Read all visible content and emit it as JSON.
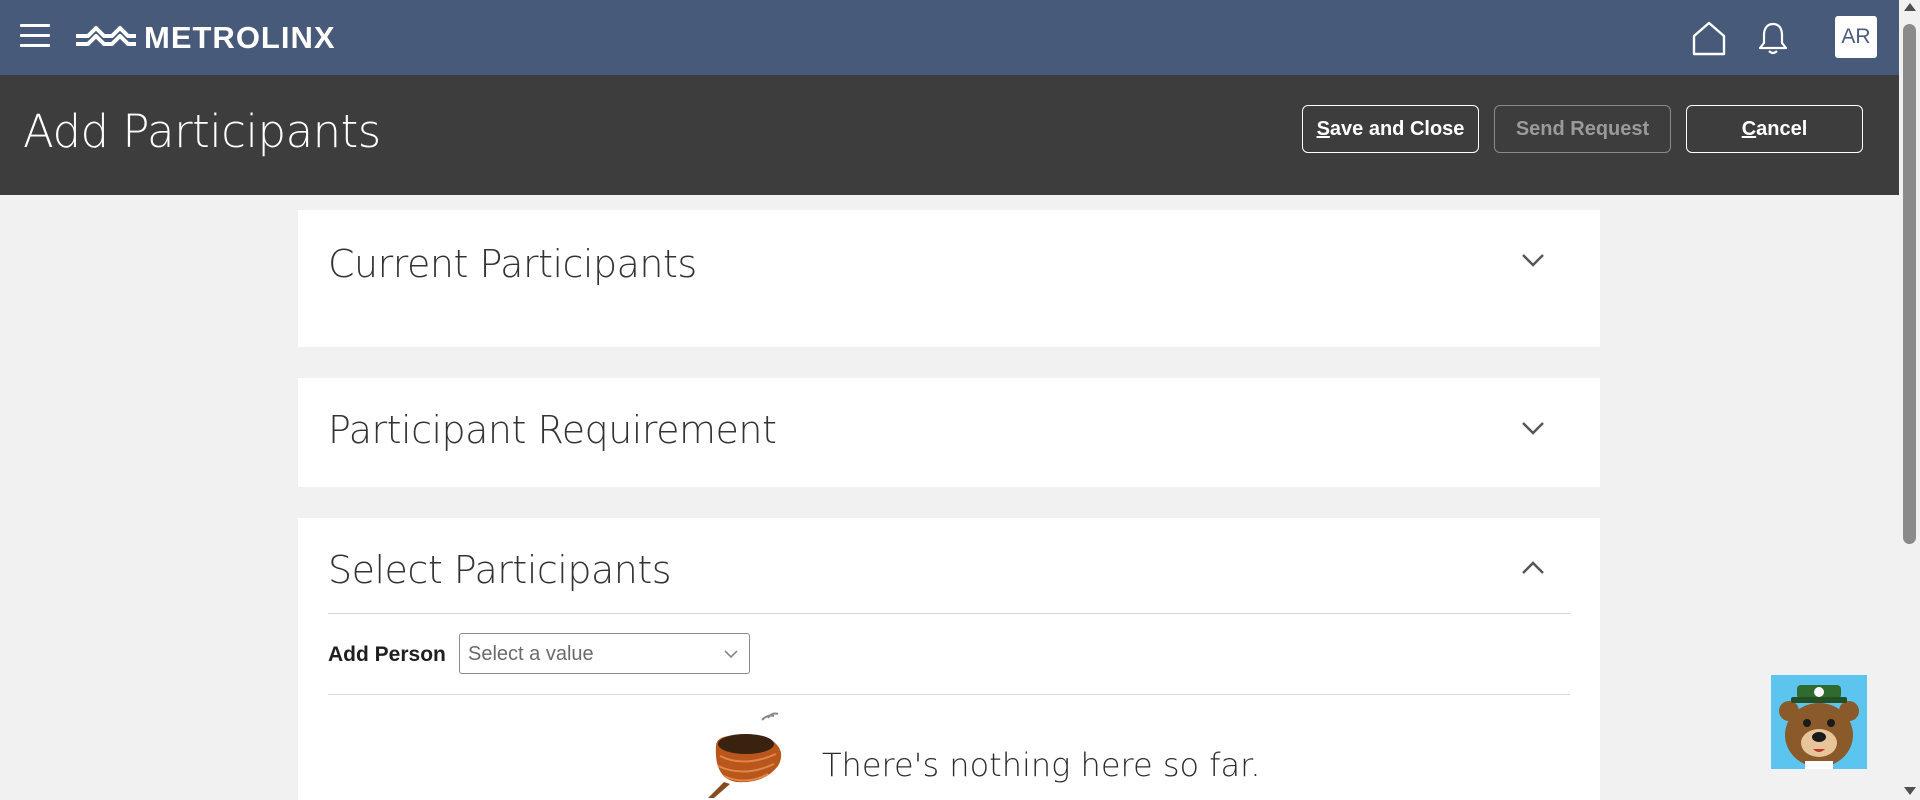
{
  "nav": {
    "brand": "METROLINX",
    "avatar_initials": "AR",
    "icons": [
      "menu-icon",
      "home-icon",
      "bell-icon"
    ]
  },
  "header": {
    "title": "Add Participants",
    "save_first": "S",
    "save_rest": "ave and Close",
    "send_label": "Send Request",
    "cancel_first": "C",
    "cancel_rest": "ancel"
  },
  "sections": {
    "current": {
      "title": "Current Participants",
      "state": "collapsed"
    },
    "requirement": {
      "title": "Participant Requirement",
      "state": "collapsed"
    },
    "select": {
      "title": "Select Participants",
      "state": "expanded",
      "add_person_label": "Add Person",
      "add_person_placeholder": "Select a value",
      "empty_message": "There's nothing here so far."
    }
  },
  "colors": {
    "nav_bg": "#475a79",
    "header_bg": "#3d3d3d",
    "page_bg": "#f1f1f1",
    "chat_bg": "#5cc5ef"
  }
}
